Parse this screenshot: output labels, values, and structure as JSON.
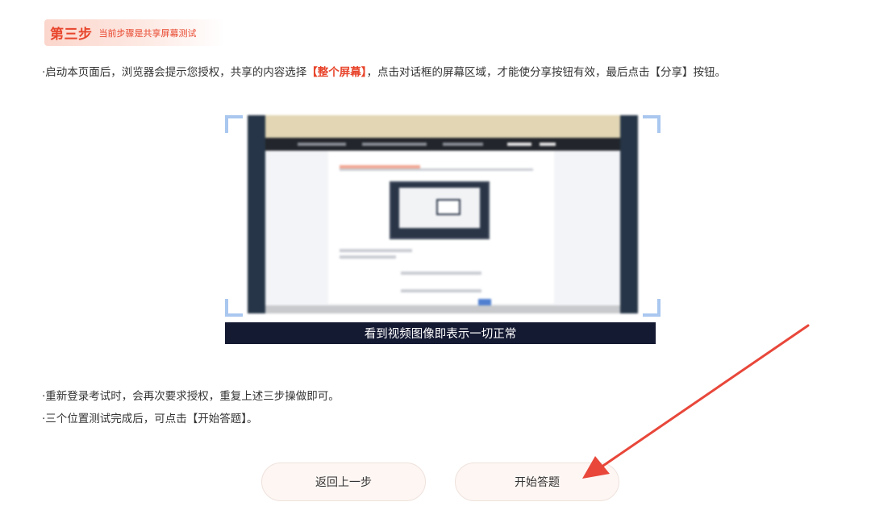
{
  "step": {
    "title": "第三步",
    "subtitle": "当前步骤是共享屏幕测试"
  },
  "instructions": {
    "line1_prefix": "·启动本页面后，浏览器会提示您授权，共享的内容选择",
    "line1_highlight": "【整个屏幕】",
    "line1_suffix": "，点击对话框的屏幕区域，才能使分享按钮有效，最后点击【分享】按钮。",
    "line2": "·重新登录考试时，会再次要求授权，重复上述三步操做即可。",
    "line3": "·三个位置测试完成后，可点击【开始答题】。"
  },
  "preview": {
    "caption": "看到视频图像即表示一切正常"
  },
  "buttons": {
    "back": "返回上一步",
    "start": "开始答题"
  },
  "colors": {
    "accent": "#e8452c",
    "caption_bg": "#151a33",
    "arrow": "#e8473a"
  }
}
